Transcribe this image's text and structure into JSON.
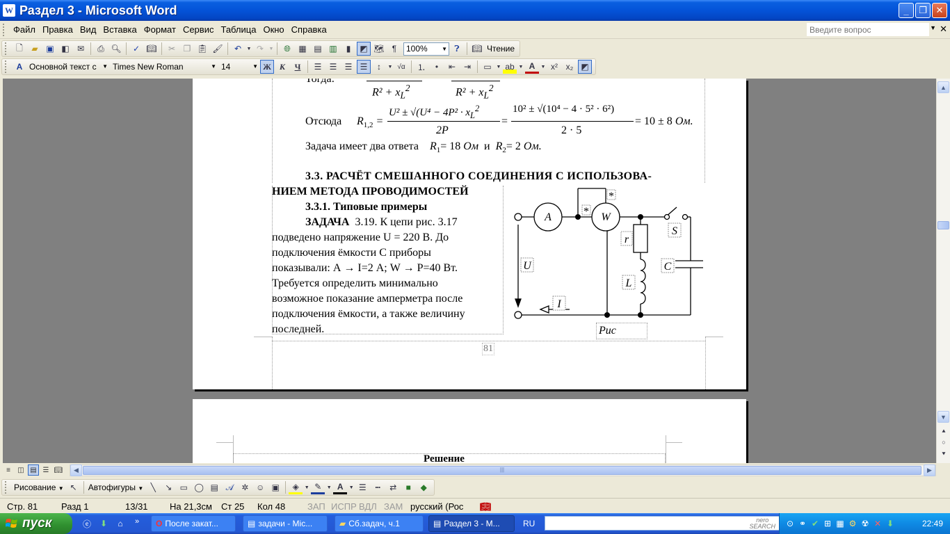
{
  "window": {
    "title": "Раздел 3 - Microsoft Word",
    "minimize": "_",
    "maximize": "❐",
    "close": "✕"
  },
  "menu": {
    "items": [
      "Файл",
      "Правка",
      "Вид",
      "Вставка",
      "Формат",
      "Сервис",
      "Таблица",
      "Окно",
      "Справка"
    ],
    "help_placeholder": "Введите вопрос"
  },
  "standard_toolbar": {
    "zoom": "100%",
    "reading_label": "Чтение"
  },
  "formatting_toolbar": {
    "style": "Основной текст с",
    "font": "Times New Roman",
    "size": "14",
    "bold": "Ж",
    "italic": "К",
    "underline": "Ч"
  },
  "document": {
    "prev_fragment_left": "Тогда:",
    "prev_denominator_1": "R² + x",
    "prev_denominator_2": "R² + x",
    "solution_label": "Отсюда",
    "r12": "R",
    "r12_sub": "1,2",
    "numerator_1": "U² ± √(U⁴ − 4P² · x",
    "denominator_1": "2P",
    "numerator_2": "10² ± √(10⁴ − 4 · 5² · 6²)",
    "denominator_2": "2 · 5",
    "result": "= 10 ± 8",
    "result_unit": "Ом.",
    "answers_intro": "Задача имеет два ответа",
    "answer_1": "= 18",
    "answer_unit": "Ом",
    "answer_and": "и",
    "answer_2": "= 2",
    "answer_unit_2": "Ом.",
    "section_heading_line1": "3.3. РАСЧЁТ СМЕШАННОГО СОЕДИНЕНИЯ С ИСПОЛЬЗОВА-",
    "section_heading_line2": "НИЕМ МЕТОДА ПРОВОДИМОСТЕЙ",
    "subsection_heading": "3.3.1. Типовые примеры",
    "task_label": "ЗАДАЧА",
    "task_lines": [
      "3.19. К цепи рис. 3.17",
      "подведено напряжение  U = 220 В.  До",
      "подключения     ёмкости  С  приборы",
      "показывали: А →  I=2 А;  W → P=40 Вт.",
      "Требуется     определить     минимально",
      "возможное показание амперметра после",
      "подключения ёмкости, а также величину",
      "последней."
    ],
    "page_number": "81",
    "figure_caption": "Рис",
    "next_page_heading": "Решение",
    "circuit_labels": {
      "ammeter": "A",
      "wattmeter": "W",
      "star": "*",
      "resistor": "r",
      "switch": "S",
      "voltage": "U",
      "capacitor": "C",
      "inductor": "L",
      "current": "I"
    }
  },
  "drawing_toolbar": {
    "draw_label": "Рисование",
    "autoshapes_label": "Автофигуры"
  },
  "status": {
    "page": "Стр. 81",
    "section": "Разд 1",
    "count": "13/31",
    "at": "На 21,3см",
    "line": "Ст 25",
    "col": "Кол 48",
    "rec": "ЗАП",
    "trk": "ИСПР",
    "ext": "ВДЛ",
    "ovr": "ЗАМ",
    "lang": "русский (Рос"
  },
  "taskbar": {
    "start": "пуск",
    "tasks": [
      "После закат...",
      "задачи - Mic...",
      "Сб.задач, ч.1",
      "Раздел 3 - М..."
    ],
    "lang": "RU",
    "nero_line1": "nero",
    "nero_line2": "SEARCH",
    "clock": "22:49"
  },
  "colors": {
    "title_blue": "#0453d8",
    "taskbar_blue": "#245edc",
    "start_green": "#2f8f2f",
    "doc_background": "#808080"
  }
}
